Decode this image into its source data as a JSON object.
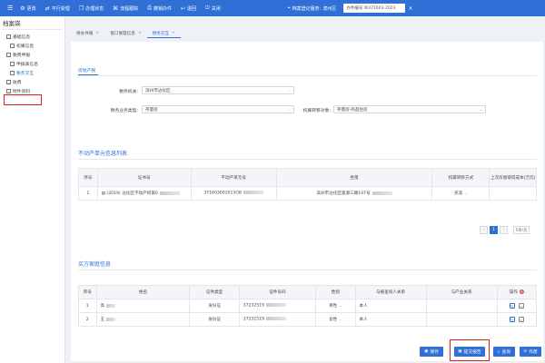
{
  "topbar": {
    "items": [
      {
        "icon": "gear-icon",
        "glyph": "⚙",
        "label": "更改"
      },
      {
        "icon": "split-icon",
        "glyph": "⇄",
        "label": "平行受理"
      },
      {
        "icon": "copy-icon",
        "glyph": "❐",
        "label": "办理状态"
      },
      {
        "icon": "flow-icon",
        "glyph": "⌘",
        "label": "流程跟踪"
      },
      {
        "icon": "print-icon",
        "glyph": "⎙",
        "label": "撤销办件"
      },
      {
        "icon": "return-icon",
        "glyph": "↩",
        "label": "退回"
      },
      {
        "icon": "power-icon",
        "glyph": "⏻",
        "label": "关闭"
      }
    ],
    "location_label": "档案登记服务:",
    "location_value": "滨州区",
    "select_value": "办件编号  W371603-2023"
  },
  "sidebar": {
    "title": "档案袋",
    "items": [
      {
        "label": "基础信息",
        "level": 0
      },
      {
        "label": "权属信息",
        "level": 1
      },
      {
        "label": "税费申报",
        "level": 0
      },
      {
        "label": "申报表信息",
        "level": 1
      },
      {
        "label": "税务交互",
        "level": 1
      },
      {
        "label": "收费",
        "level": 0
      },
      {
        "label": "附件资料",
        "level": 0
      }
    ]
  },
  "tabs": [
    {
      "label": "待办件箱",
      "active": false
    },
    {
      "label": "窗口受理信息",
      "active": false
    },
    {
      "label": "税务交互",
      "active": true
    }
  ],
  "subtab": "房地产税",
  "form": {
    "tax_authority_label": "税务机关:",
    "tax_authority_value": "滨州市沾化区",
    "business_type_label": "税务业务类型:",
    "business_type_value": "存量房",
    "transfer_object_label": "权属转移对象:",
    "transfer_object_value": "存量房·商品住房"
  },
  "realty": {
    "title": "不动产单元信息列表",
    "headers": [
      "序号",
      "证书号",
      "不动产单元号",
      "坐落",
      "权属转移方式",
      "上次房屋取得成本(万元)"
    ],
    "rows": [
      {
        "index": "1",
        "cert": "(2019) 沾化区不动产权第0",
        "unit": "371603001013GB",
        "location": "滨州市沾化区富源三路107号",
        "method": "买卖",
        "cost": ""
      }
    ],
    "pager": {
      "prev": "‹",
      "page": "1",
      "next": "›",
      "size": "5条/页"
    }
  },
  "parties": {
    "title": "买方家庭信息",
    "headers": [
      "序号",
      "姓名",
      "证件类型",
      "证件号码",
      "性别",
      "与被查询人关系",
      "与产业关系",
      "操作"
    ],
    "rows": [
      {
        "index": "1",
        "name": "高",
        "id_type": "身份证",
        "id_no": "37232519",
        "gender": "男性",
        "relation": "本人",
        "property": ""
      },
      {
        "index": "2",
        "name": "王",
        "id_type": "身份证",
        "id_no": "37232519",
        "gender": "女性",
        "relation": "本人",
        "property": ""
      }
    ]
  },
  "actions": {
    "save": "保存",
    "submit": "提交报告",
    "query": "查询",
    "void": "作废"
  }
}
